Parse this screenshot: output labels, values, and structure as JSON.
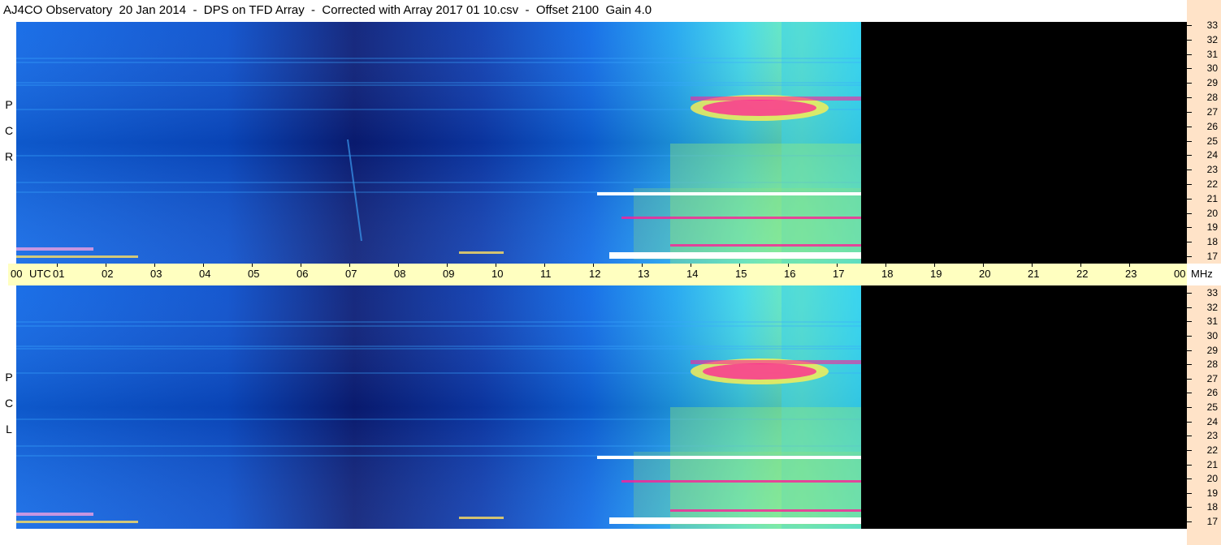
{
  "title": "AJ4CO Observatory  20 Jan 2014  -  DPS on TFD Array  -  Corrected with Array 2017 01 10.csv  -  Offset 2100  Gain 4.0",
  "panels": [
    {
      "name": "rcp",
      "label": [
        "R",
        "C",
        "P"
      ]
    },
    {
      "name": "lcp",
      "label": [
        "L",
        "C",
        "P"
      ]
    }
  ],
  "time_axis": {
    "start_label": "00",
    "utc_label": "UTC",
    "hours": [
      "01",
      "02",
      "03",
      "04",
      "05",
      "06",
      "07",
      "08",
      "09",
      "10",
      "11",
      "12",
      "13",
      "14",
      "15",
      "16",
      "17",
      "18",
      "19",
      "20",
      "21",
      "22",
      "23"
    ],
    "end_label": "00",
    "unit_label": "MHz"
  },
  "freq_scale": {
    "labels": [
      "33",
      "32",
      "31",
      "30",
      "29",
      "28",
      "27",
      "26",
      "25",
      "24",
      "23",
      "22",
      "21",
      "20",
      "19",
      "18",
      "17"
    ]
  },
  "colors": {
    "deep": "#0a1e78",
    "mid": "#0a50d2",
    "cyan": "#32c8f0",
    "green": "#a0f06e",
    "yellow": "#fff050",
    "magenta": "#ff1e96",
    "background_black": "#000000",
    "axis_bg": "#ffffc0",
    "scale_bg": "#ffe3c8"
  }
}
